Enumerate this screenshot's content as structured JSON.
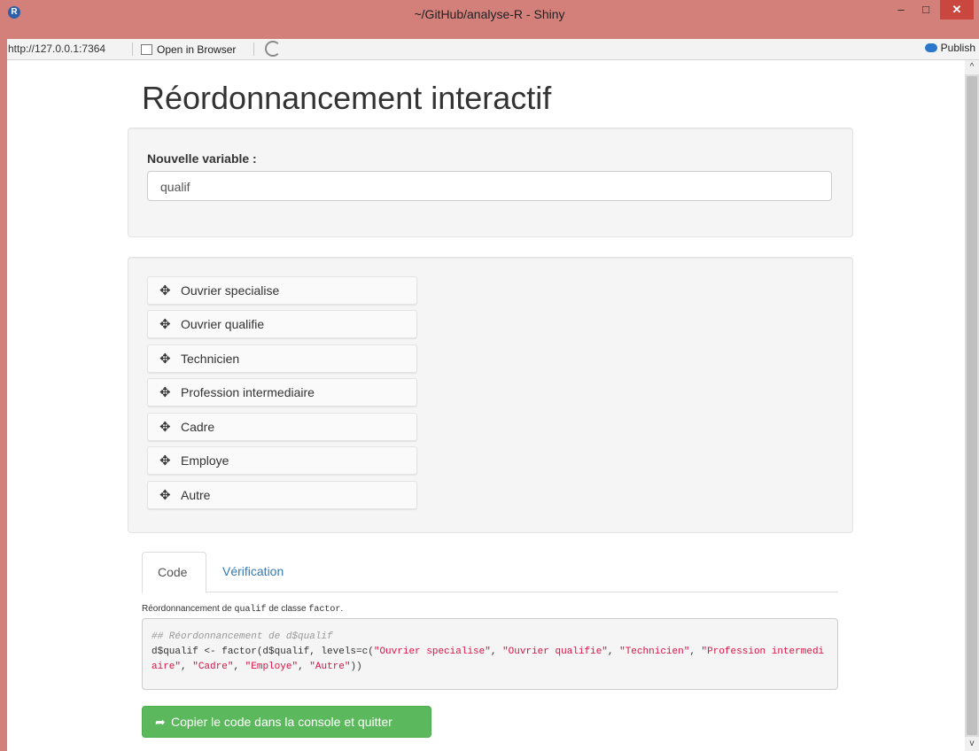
{
  "window": {
    "title": "~/GitHub/analyse-R - Shiny",
    "logo": "R",
    "minimize": "–",
    "maximize": "□",
    "close": "✕"
  },
  "toolbar": {
    "url": "http://127.0.0.1:7364",
    "open_in_browser": "Open in Browser",
    "publish": "Publish"
  },
  "page": {
    "title": "Réordonnancement interactif",
    "variable_label": "Nouvelle variable :",
    "variable_value": "qualif"
  },
  "sortable": {
    "move_glyph": "✥",
    "items": [
      "Ouvrier specialise",
      "Ouvrier qualifie",
      "Technicien",
      "Profession intermediaire",
      "Cadre",
      "Employe",
      "Autre"
    ]
  },
  "tabs": {
    "code": "Code",
    "verification": "Vérification"
  },
  "description": {
    "prefix": "Réordonnancement de ",
    "var": "qualif",
    "middle": " de classe ",
    "class": "factor",
    "suffix": "."
  },
  "code": {
    "comment": "## Réordonnancement de d$qualif",
    "prefix": "d$qualif <- factor(d$qualif, levels=c(",
    "levels": [
      "\"Ouvrier specialise\"",
      "\"Ouvrier qualifie\"",
      "\"Technicien\"",
      "\"Profession intermediaire\"",
      "\"Cadre\"",
      "\"Employe\"",
      "\"Autre\""
    ],
    "suffix": "))"
  },
  "buttons": {
    "copy_icon": "➦",
    "copy_label": "Copier le code dans la console et quitter"
  },
  "scroll": {
    "up": "^",
    "down": "v"
  }
}
